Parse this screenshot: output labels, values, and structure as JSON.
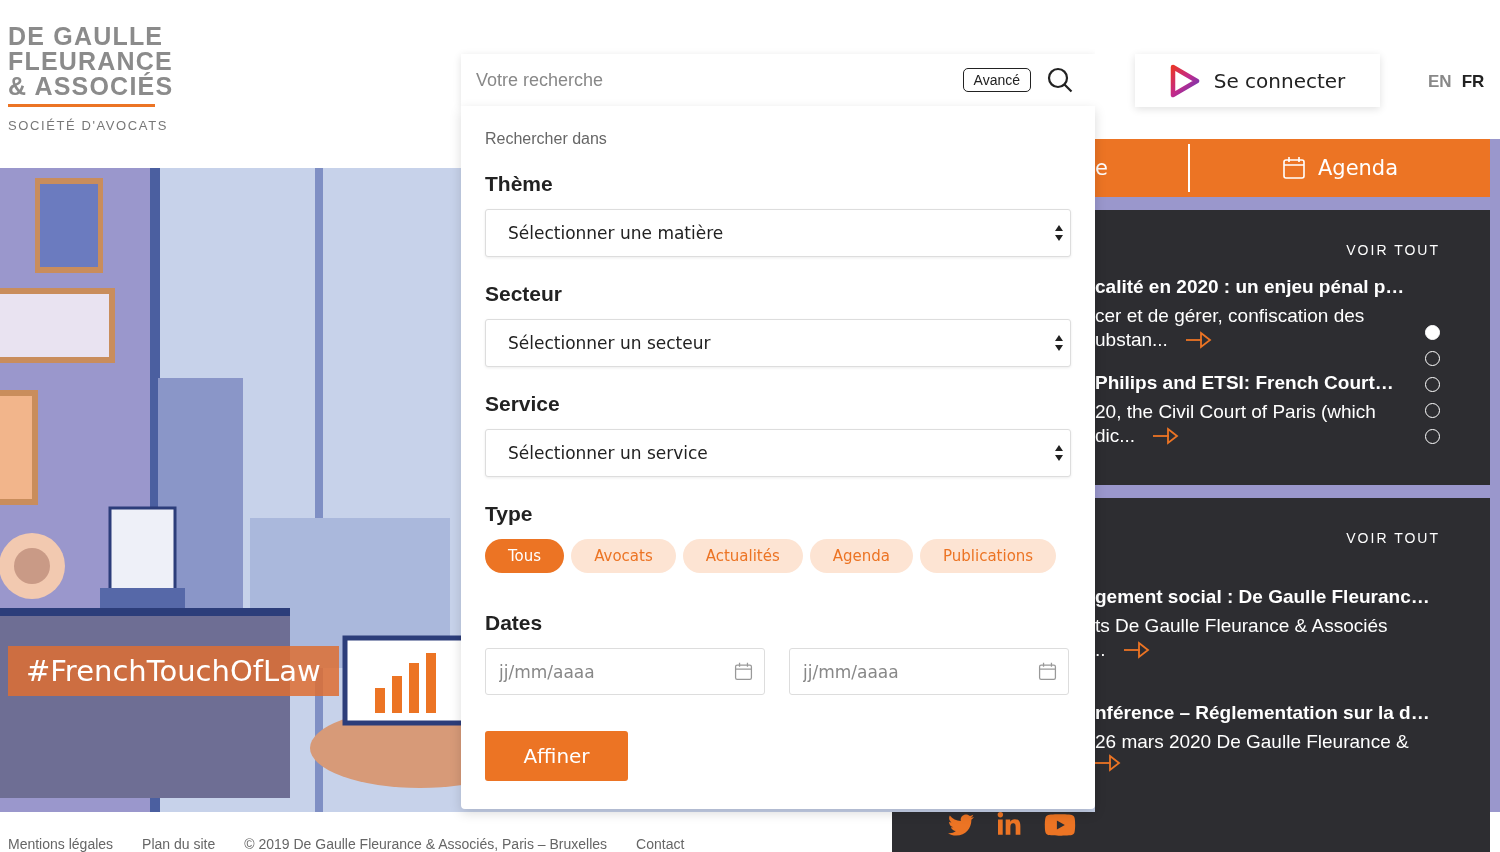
{
  "logo": {
    "lines": [
      "DE GAULLE",
      "FLEURANCE",
      "& ASSOCIÉS"
    ],
    "tagline": "SOCIÉTÉ D'AVOCATS"
  },
  "search": {
    "placeholder": "Votre recherche",
    "advanced": "Avancé"
  },
  "login": {
    "label": "Se connecter"
  },
  "languages": [
    {
      "label": "EN",
      "selected": false
    },
    {
      "label": "FR",
      "selected": true
    }
  ],
  "hero": {
    "hashtag": "#FrenchTouchOfLaw"
  },
  "nav": [
    {
      "label": "e",
      "kind": "text"
    },
    {
      "label": "Agenda",
      "kind": "calendar"
    }
  ],
  "panels": [
    {
      "see_all": "VOIR TOUT",
      "dots": [
        {
          "selected": true
        },
        {
          "selected": false
        },
        {
          "selected": false
        },
        {
          "selected": false
        },
        {
          "selected": false
        }
      ],
      "items": [
        {
          "title": "calité en 2020 : un enjeu pénal p…",
          "lines": [
            "cer et de gérer, confiscation des"
          ],
          "tail": "ubstan..."
        },
        {
          "title": "Philips and ETSI: French Court…",
          "lines": [
            "20, the Civil Court of Paris (which"
          ],
          "tail": "dic..."
        }
      ]
    },
    {
      "see_all": "VOIR TOUT",
      "items": [
        {
          "title": "gement social : De Gaulle Fleuranc…",
          "lines": [
            "ts De Gaulle Fleurance & Associés"
          ],
          "tail": ".."
        },
        {
          "title": "nférence – Réglementation sur la d…",
          "lines": [
            "26 mars 2020 De Gaulle Fleurance &"
          ]
        }
      ]
    }
  ],
  "filter": {
    "heading": "Rechercher dans",
    "selects": [
      {
        "label": "Thème",
        "value": "Sélectionner une matière"
      },
      {
        "label": "Secteur",
        "value": "Sélectionner un secteur"
      },
      {
        "label": "Service",
        "value": "Sélectionner un service"
      }
    ],
    "type": {
      "label": "Type",
      "options": [
        {
          "label": "Tous",
          "selected": true
        },
        {
          "label": "Avocats",
          "selected": false
        },
        {
          "label": "Actualités",
          "selected": false
        },
        {
          "label": "Agenda",
          "selected": false
        },
        {
          "label": "Publications",
          "selected": false
        }
      ]
    },
    "dates": {
      "label": "Dates",
      "fields": [
        {
          "placeholder": "jj/mm/aaaa"
        },
        {
          "placeholder": "jj/mm/aaaa"
        }
      ]
    },
    "submit": "Affiner"
  },
  "footer": {
    "links": [
      "Mentions légales",
      "Plan du site",
      "© 2019 De Gaulle Fleurance & Associés, Paris – Bruxelles",
      "Contact"
    ]
  }
}
